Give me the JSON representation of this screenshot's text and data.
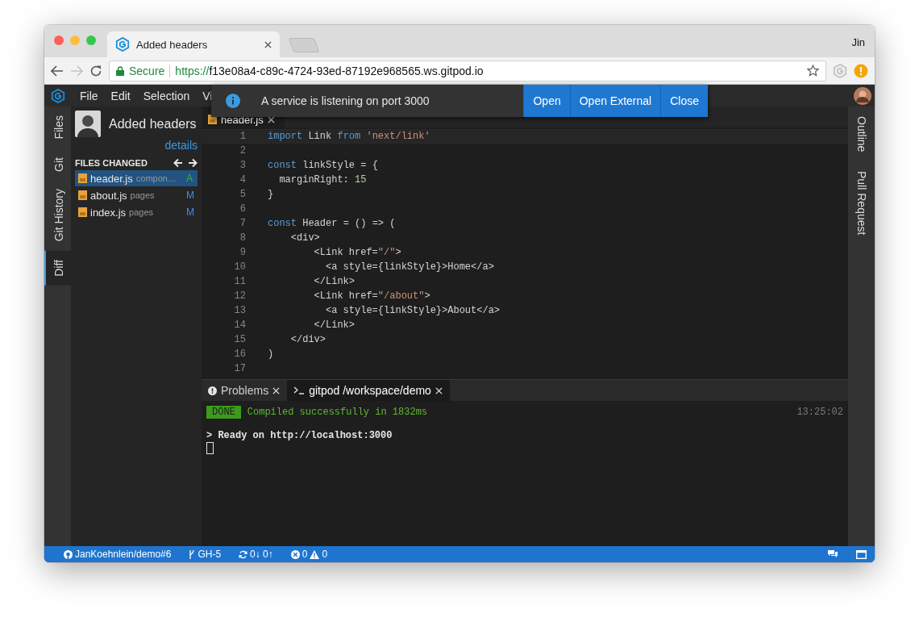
{
  "browser": {
    "tab": {
      "title": "Added headers"
    },
    "profile": "Jin",
    "forward_disabled": true,
    "security": "Secure",
    "url_scheme": "https://",
    "url_rest": "f13e08a4-c89c-4724-93ed-87192e968565.ws.gitpod.io"
  },
  "menu": [
    "File",
    "Edit",
    "Selection",
    "Vi"
  ],
  "notification": {
    "message": "A service is listening on port 3000",
    "buttons": [
      "Open",
      "Open External",
      "Close"
    ]
  },
  "activity_bar": [
    {
      "label": "Files",
      "selected": false
    },
    {
      "label": "Git",
      "selected": false
    },
    {
      "label": "Git History",
      "selected": false
    },
    {
      "label": "Diff",
      "selected": true
    }
  ],
  "changes": {
    "title": "Added headers",
    "details_link": "details",
    "section": "FILES CHANGED",
    "files": [
      {
        "name": "header.js",
        "folder": "compon…",
        "status": "A",
        "color": "#3fae4a",
        "selected": true
      },
      {
        "name": "about.js",
        "folder": "pages",
        "status": "M",
        "color": "#3b8eea",
        "selected": false
      },
      {
        "name": "index.js",
        "folder": "pages",
        "status": "M",
        "color": "#3b8eea",
        "selected": false
      }
    ]
  },
  "editor": {
    "tabs": [
      {
        "label": "header.js",
        "selected": true
      }
    ],
    "lines": [
      {
        "number": "1",
        "current": true,
        "tokens": [
          {
            "kind": "keyword",
            "text": "import"
          },
          {
            "kind": "plain",
            "text": " Link "
          },
          {
            "kind": "keyword",
            "text": "from"
          },
          {
            "kind": "string",
            "text": " 'next/link'"
          }
        ]
      },
      {
        "number": "2",
        "current": false
      },
      {
        "number": "3",
        "current": false,
        "tokens": [
          {
            "kind": "keyword",
            "text": "const"
          },
          {
            "kind": "plain",
            "text": " linkStyle = {"
          }
        ]
      },
      {
        "number": "4",
        "current": false,
        "tokens": [
          {
            "kind": "plain",
            "text": "  marginRight: "
          },
          {
            "kind": "number",
            "text": "15"
          }
        ]
      },
      {
        "number": "5",
        "current": false,
        "tokens": [
          {
            "kind": "plain",
            "text": "}"
          }
        ]
      },
      {
        "number": "6",
        "current": false
      },
      {
        "number": "7",
        "current": false,
        "tokens": [
          {
            "kind": "keyword",
            "text": "const"
          },
          {
            "kind": "plain",
            "text": " Header = () => ("
          }
        ]
      },
      {
        "number": "8",
        "current": false,
        "tokens": [
          {
            "kind": "plain",
            "text": "    <div>"
          }
        ]
      },
      {
        "number": "9",
        "current": false,
        "tokens": [
          {
            "kind": "plain",
            "text": "        <Link href="
          },
          {
            "kind": "string",
            "text": "\"/\""
          },
          {
            "kind": "plain",
            "text": ">"
          }
        ]
      },
      {
        "number": "10",
        "current": false,
        "tokens": [
          {
            "kind": "plain",
            "text": "          <a style={linkStyle}>Home</a>"
          }
        ]
      },
      {
        "number": "11",
        "current": false,
        "tokens": [
          {
            "kind": "plain",
            "text": "        </Link>"
          }
        ]
      },
      {
        "number": "12",
        "current": false,
        "tokens": [
          {
            "kind": "plain",
            "text": "        <Link href="
          },
          {
            "kind": "string",
            "text": "\"/about\""
          },
          {
            "kind": "plain",
            "text": ">"
          }
        ]
      },
      {
        "number": "13",
        "current": false,
        "tokens": [
          {
            "kind": "plain",
            "text": "          <a style={linkStyle}>About</a>"
          }
        ]
      },
      {
        "number": "14",
        "current": false,
        "tokens": [
          {
            "kind": "plain",
            "text": "        </Link>"
          }
        ]
      },
      {
        "number": "15",
        "current": false,
        "tokens": [
          {
            "kind": "plain",
            "text": "    </div>"
          }
        ]
      },
      {
        "number": "16",
        "current": false,
        "tokens": [
          {
            "kind": "plain",
            "text": ")"
          }
        ]
      },
      {
        "number": "17",
        "current": false
      }
    ]
  },
  "panel": {
    "tabs": [
      {
        "label": "Problems",
        "kind": "problems",
        "selected": false
      },
      {
        "label": "gitpod /workspace/demo",
        "kind": "terminal",
        "selected": true
      }
    ],
    "terminal": {
      "badge": "DONE",
      "message": "Compiled successfully in 1832ms",
      "time": "13:25:02",
      "output": "> Ready on http://localhost:3000"
    }
  },
  "right_bar": [
    "Outline",
    "Pull Request"
  ],
  "status_bar": {
    "repo": "JanKoehnlein/demo#6",
    "branch": "GH-5",
    "sync": "0↓ 0↑",
    "errors": "0",
    "warnings": "0"
  }
}
